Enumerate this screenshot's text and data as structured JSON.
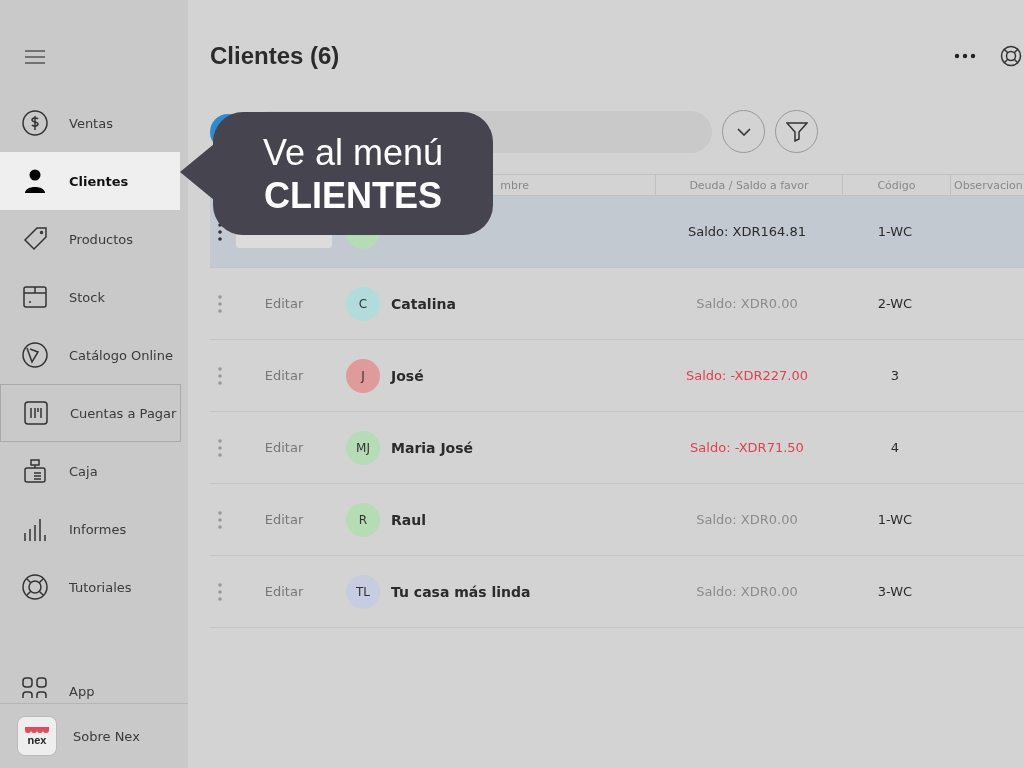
{
  "sidebar": {
    "items": [
      {
        "label": "Ventas",
        "selected": false,
        "outlined": false
      },
      {
        "label": "Clientes",
        "selected": true,
        "outlined": false
      },
      {
        "label": "Productos",
        "selected": false,
        "outlined": false
      },
      {
        "label": "Stock",
        "selected": false,
        "outlined": false
      },
      {
        "label": "Catálogo Online",
        "selected": false,
        "outlined": false
      },
      {
        "label": "Cuentas a Pagar",
        "selected": false,
        "outlined": true
      },
      {
        "label": "Caja",
        "selected": false,
        "outlined": false
      },
      {
        "label": "Informes",
        "selected": false,
        "outlined": false
      },
      {
        "label": "Tutoriales",
        "selected": false,
        "outlined": false
      }
    ],
    "bottom": [
      {
        "label": "App"
      },
      {
        "label": "Sobre Nex",
        "logo": "nex"
      }
    ]
  },
  "header": {
    "title": "Clientes (6)"
  },
  "table": {
    "columns": [
      "mbre",
      "Deuda / Saldo a favor",
      "Código",
      "Observacion"
    ],
    "rows": [
      {
        "selected": true,
        "color": "#b5dcb5",
        "balance": "Saldo: XDR164.81",
        "negative": false,
        "settled": false,
        "code": "1-WC"
      },
      {
        "selected": false,
        "edit": "Editar",
        "initials": "C",
        "color": "#b2dcdc",
        "name": "Catalina",
        "balance": "Saldo: XDR0.00",
        "negative": false,
        "settled": true,
        "code": "2-WC"
      },
      {
        "selected": false,
        "edit": "Editar",
        "initials": "J",
        "color": "#df9a9a",
        "name": "José",
        "balance": "Saldo: -XDR227.00",
        "negative": true,
        "settled": false,
        "code": "3"
      },
      {
        "selected": false,
        "edit": "Editar",
        "initials": "MJ",
        "color": "#b5dcb5",
        "name": "Maria José",
        "balance": "Saldo: -XDR71.50",
        "negative": true,
        "settled": false,
        "code": "4"
      },
      {
        "selected": false,
        "edit": "Editar",
        "initials": "R",
        "color": "#b5dcb5",
        "name": "Raul",
        "balance": "Saldo: XDR0.00",
        "negative": false,
        "settled": true,
        "code": "1-WC"
      },
      {
        "selected": false,
        "edit": "Editar",
        "initials": "TL",
        "color": "#c6cde0",
        "name": "Tu casa más linda",
        "balance": "Saldo: XDR0.00",
        "negative": false,
        "settled": true,
        "code": "3-WC"
      }
    ]
  },
  "callout": {
    "line1": "Ve al menú",
    "line2": "CLIENTES"
  }
}
